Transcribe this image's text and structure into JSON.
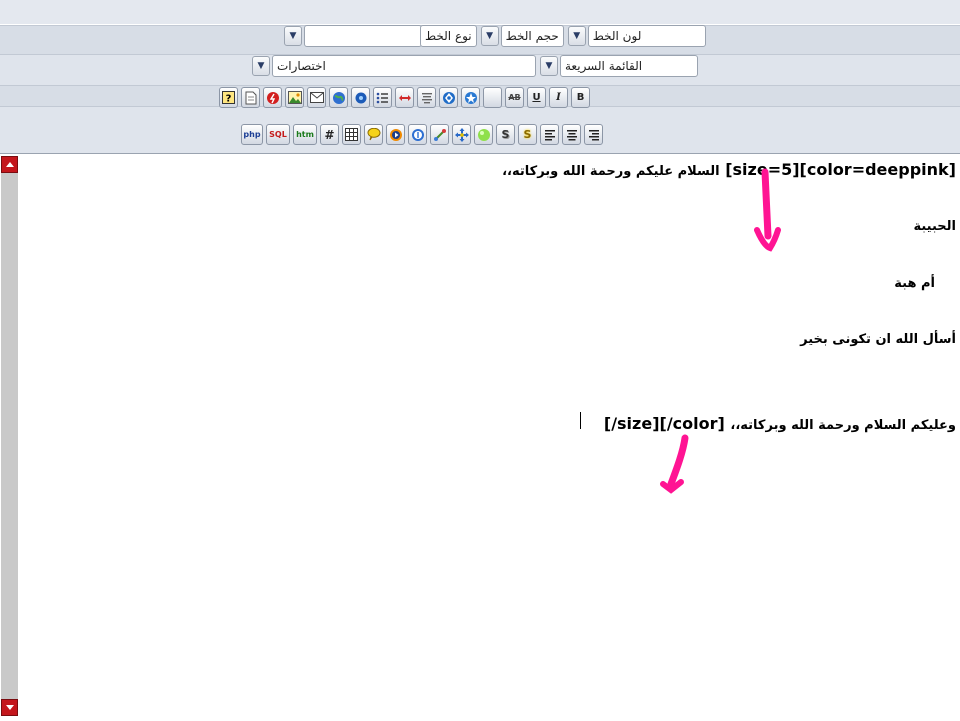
{
  "toolbar": {
    "font_color_label": "لون الخط",
    "font_size_label": "حجم الخط",
    "font_type_label": "نوع الخط",
    "quick_menu_label": "القائمة السريعة",
    "shortcuts_label": "اختصارات"
  },
  "buttons_row1": [
    "help-icon",
    "page-icon",
    "flash-icon",
    "image-icon",
    "email-icon",
    "web-icon",
    "media-icon",
    "list-icon",
    "move-icon",
    "align-icon",
    "diamond-icon",
    "sparkle-icon",
    "blank-icon",
    "strikethrough-icon",
    "underline-icon",
    "italic-icon",
    "bold-icon"
  ],
  "buttons_row2": [
    "php-icon",
    "sql-icon",
    "html-icon",
    "hash-icon",
    "table-icon",
    "quote-icon",
    "play-icon",
    "info-icon",
    "link-icon",
    "move-arrows-icon",
    "bubble-icon",
    "shadow-icon",
    "glow-icon",
    "align-left-icon",
    "align-center-icon",
    "align-right-icon"
  ],
  "button_text": {
    "php": "php",
    "sql": "SQL",
    "htm": "htm",
    "hash": "#",
    "strike": "AB",
    "underline": "U",
    "italic": "I",
    "bold": "B",
    "shadow": "S",
    "glow": "S"
  },
  "editor": {
    "line1_code": "[size=5][color=deeppink]",
    "line1_text": "السلام عليكم ورحمة الله وبركاته،،",
    "line2": "الحبيبة",
    "line3": "أم هبة",
    "line4": "أسأل الله ان تكونى بخير",
    "line5_text": "وعليكم السلام ورحمة الله وبركاته،،",
    "line5_code": "[/size][/color]"
  },
  "colors": {
    "annotation_arrow": "#ff1493",
    "scroll_button": "#c4161c"
  }
}
